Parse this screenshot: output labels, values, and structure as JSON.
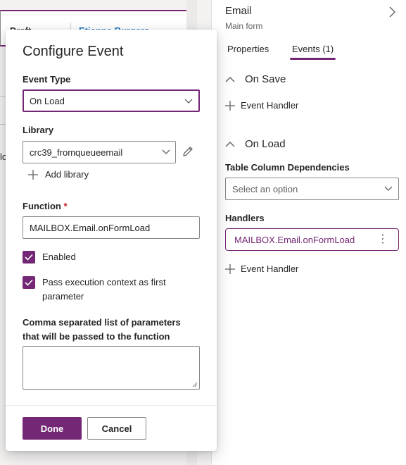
{
  "background_form": {
    "status": "Draft",
    "owner": "Etienne Burgers",
    "partial_text": "lc"
  },
  "right_panel": {
    "title": "Email",
    "subtitle": "Main form",
    "tabs": [
      {
        "label": "Properties"
      },
      {
        "label": "Events (1)"
      }
    ],
    "on_save": {
      "heading": "On Save",
      "add_handler_label": "Event Handler"
    },
    "on_load": {
      "heading": "On Load",
      "dependencies_label": "Table Column Dependencies",
      "dependencies_placeholder": "Select an option",
      "handlers_label": "Handlers",
      "handler_item": "MAILBOX.Email.onFormLoad",
      "add_handler_label": "Event Handler"
    }
  },
  "modal": {
    "title": "Configure Event",
    "event_type_label": "Event Type",
    "event_type_value": "On Load",
    "library_label": "Library",
    "library_value": "crc39_fromqueueemail",
    "add_library_label": "Add library",
    "function_label": "Function",
    "function_required": "*",
    "function_value": "MAILBOX.Email.onFormLoad",
    "enabled_label": "Enabled",
    "enabled_checked": true,
    "pass_context_label": "Pass execution context as first parameter",
    "pass_context_checked": true,
    "parameters_label": "Comma separated list of parameters that will be passed to the function",
    "parameters_value": "",
    "done_label": "Done",
    "cancel_label": "Cancel"
  },
  "colors": {
    "accent": "#742774",
    "text": "#242424",
    "border": "#8a8886"
  }
}
